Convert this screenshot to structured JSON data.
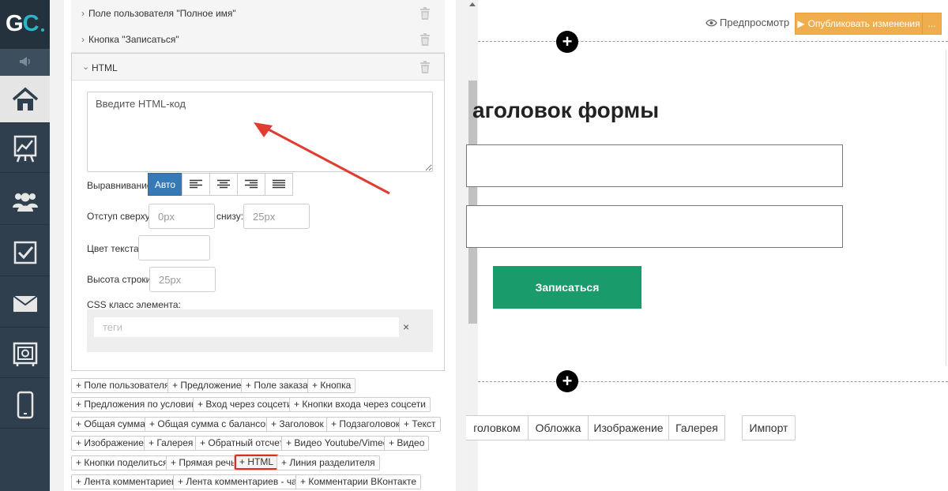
{
  "logo": {
    "text_g": "G",
    "text_c": "C"
  },
  "sidebar": {
    "items": [
      {
        "name": "home",
        "icon": "home-icon"
      },
      {
        "name": "stats",
        "icon": "chart-icon"
      },
      {
        "name": "users",
        "icon": "users-icon"
      },
      {
        "name": "tasks",
        "icon": "checkbox-icon"
      },
      {
        "name": "messages",
        "icon": "mail-icon"
      },
      {
        "name": "safe",
        "icon": "safe-icon"
      },
      {
        "name": "mobile",
        "icon": "phone-icon"
      }
    ]
  },
  "panel": {
    "accordion": {
      "user_field": "Поле пользователя \"Полное имя\"",
      "signup_button": "Кнопка \"Записаться\"",
      "html": "HTML"
    },
    "html_editor": {
      "code_placeholder": "Введите HTML-код",
      "align_label": "Выравнивание",
      "align_auto": "Авто",
      "padding_top_label": "Отступ сверху:",
      "padding_top_placeholder": "0px",
      "padding_bottom_label": "снизу:",
      "padding_bottom_placeholder": "25px",
      "text_color_label": "Цвет текста:",
      "line_height_label": "Высота строки:",
      "line_height_placeholder": "25px",
      "css_class_label": "CSS класс элемента:",
      "tags_placeholder": "теги",
      "tags_clear": "×"
    },
    "add_elements": [
      "+ Поле пользователя",
      "+ Предложение",
      "+ Поле заказа",
      "+ Кнопка",
      "+ Предложения по условию",
      "+ Вход через соцсети",
      "+ Кнопки входа через соцсети",
      "+ Общая сумма",
      "+ Общая сумма с балансом",
      "+ Заголовок",
      "+ Подзаголовок",
      "+ Текст",
      "+ Изображение",
      "+ Галерея",
      "+ Обратный отсчет",
      "+ Видео Youtube/Vimeo",
      "+ Видео",
      "+ Кнопки поделиться",
      "+ Прямая речь",
      "+ HTML",
      "+ Линия разделителя",
      "+ Лента комментариев",
      "+ Лента комментариев - чат",
      "+ Комментарии ВКонтакте"
    ]
  },
  "topbar": {
    "preview": "Предпросмотр",
    "publish": "Опубликовать изменения",
    "publish_more": "..."
  },
  "page": {
    "form_title": "аголовок формы",
    "submit": "Записаться",
    "plus": "+",
    "block_tabs": [
      "головком",
      "Обложка",
      "Изображение",
      "Галерея"
    ],
    "import": "Импорт"
  },
  "colors": {
    "sidebar": "#2f3f4e",
    "primary": "#337ab7",
    "publish": "#f0ad4e",
    "submit": "#1a9b6c",
    "arrow": "#e03c31"
  }
}
